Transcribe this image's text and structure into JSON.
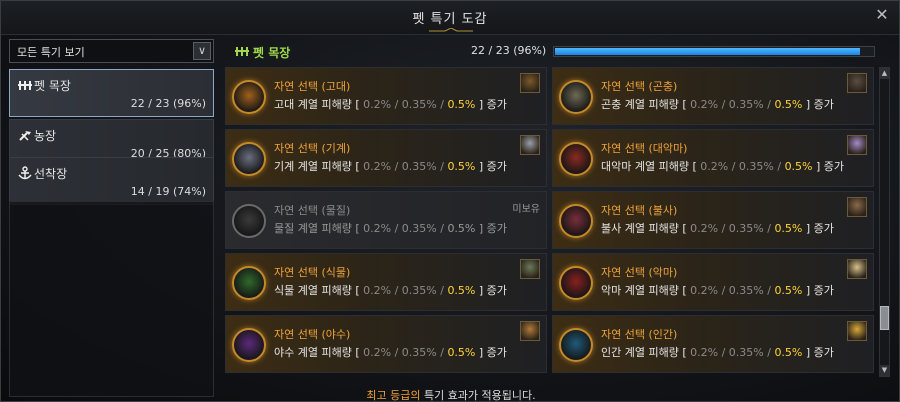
{
  "window": {
    "title": "펫 특기 도감"
  },
  "filter": {
    "selected": "모든 특기 보기"
  },
  "categories": [
    {
      "label": "펫 목장",
      "count": "22 / 23 (96%)",
      "icon": "pet-ranch-icon"
    },
    {
      "label": "농장",
      "count": "20 / 25 (80%)",
      "icon": "farm-icon"
    },
    {
      "label": "선착장",
      "count": "14 / 19 (74%)",
      "icon": "anchor-icon"
    }
  ],
  "header": {
    "title": "펫 목장",
    "count": "22 / 23 (96%)",
    "progress": 0.96
  },
  "cards": [
    {
      "name": "자연 선택 (고대)",
      "desc_prefix": "고대 계열 피해량 [ ",
      "v1": "0.2%",
      "v2": "0.35%",
      "v3": "0.5%",
      "desc_suffix": " ] 증가",
      "owned": true,
      "orb_color": "#a0601c",
      "thumb_color": "#7a5a2a"
    },
    {
      "name": "자연 선택 (곤충)",
      "desc_prefix": "곤충 계열 피해량 [ ",
      "v1": "0.2%",
      "v2": "0.35%",
      "v3": "0.5%",
      "desc_suffix": " ] 증가",
      "owned": true,
      "orb_color": "#6e6a55",
      "thumb_color": "#5a4e44"
    },
    {
      "name": "자연 선택 (기계)",
      "desc_prefix": "기계 계열 피해량 [ ",
      "v1": "0.2%",
      "v2": "0.35%",
      "v3": "0.5%",
      "desc_suffix": " ] 증가",
      "owned": true,
      "orb_color": "#6a6f80",
      "thumb_color": "#9a9ea8"
    },
    {
      "name": "자연 선택 (대악마)",
      "desc_prefix": "대악마 계열 피해량 [ ",
      "v1": "0.2%",
      "v2": "0.35%",
      "v3": "0.5%",
      "desc_suffix": " ] 증가",
      "owned": true,
      "orb_color": "#8a2a22",
      "thumb_color": "#a58ac8"
    },
    {
      "name": "자연 선택 (물질)",
      "desc_prefix": "물질 계열 피해량 [ ",
      "v1": "0.2%",
      "v2": "0.35%",
      "v3": "0.5%",
      "desc_suffix": " ] 증가",
      "owned": false,
      "badge": "미보유",
      "orb_color": "#3a3a3a",
      "thumb_color": ""
    },
    {
      "name": "자연 선택 (불사)",
      "desc_prefix": "불사 계열 피해량 [ ",
      "v1": "0.2%",
      "v2": "0.35%",
      "v3": "0.5%",
      "desc_suffix": " ] 증가",
      "owned": true,
      "orb_color": "#7a2e3a",
      "thumb_color": "#8a6a4a"
    },
    {
      "name": "자연 선택 (식물)",
      "desc_prefix": "식물 계열 피해량 [ ",
      "v1": "0.2%",
      "v2": "0.35%",
      "v3": "0.5%",
      "desc_suffix": " ] 증가",
      "owned": true,
      "orb_color": "#2f6a2a",
      "thumb_color": "#6a7a5a"
    },
    {
      "name": "자연 선택 (악마)",
      "desc_prefix": "악마 계열 피해량 [ ",
      "v1": "0.2%",
      "v2": "0.35%",
      "v3": "0.5%",
      "desc_suffix": " ] 증가",
      "owned": true,
      "orb_color": "#8a2020",
      "thumb_color": "#d8c08a"
    },
    {
      "name": "자연 선택 (야수)",
      "desc_prefix": "야수 계열 피해량 [ ",
      "v1": "0.2%",
      "v2": "0.35%",
      "v3": "0.5%",
      "desc_suffix": " ] 증가",
      "owned": true,
      "orb_color": "#5a2a7a",
      "thumb_color": "#b07a3a"
    },
    {
      "name": "자연 선택 (인간)",
      "desc_prefix": "인간 계열 피해량 [ ",
      "v1": "0.2%",
      "v2": "0.35%",
      "v3": "0.5%",
      "desc_suffix": " ] 증가",
      "owned": true,
      "orb_color": "#1f5a7a",
      "thumb_color": "#d8a83a"
    }
  ],
  "footer": {
    "highlight": "최고 등급의",
    "text": " 특기 효과가 적용됩니다."
  }
}
